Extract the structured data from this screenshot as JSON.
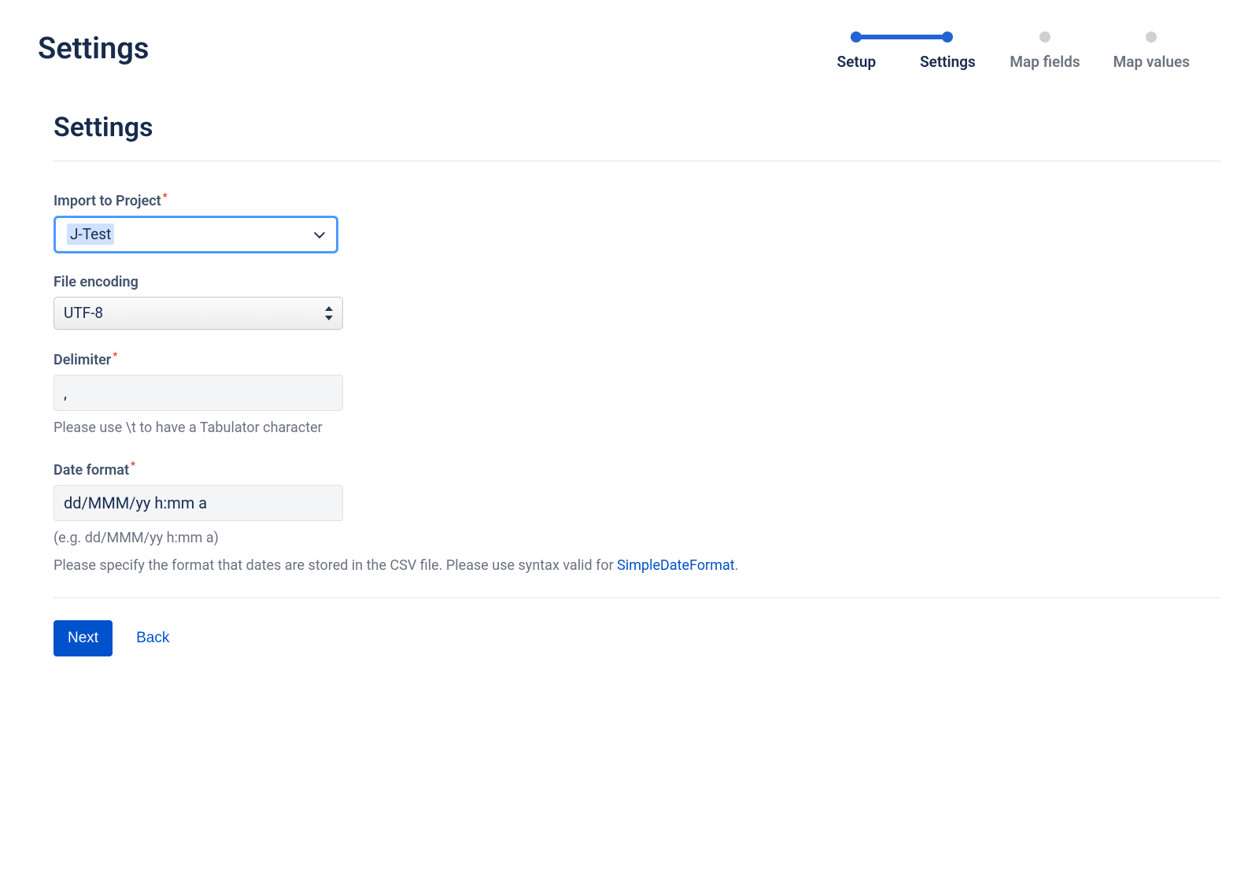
{
  "header": {
    "page_title": "Settings"
  },
  "stepper": {
    "steps": [
      {
        "label": "Setup",
        "state": "done"
      },
      {
        "label": "Settings",
        "state": "current"
      },
      {
        "label": "Map fields",
        "state": "future"
      },
      {
        "label": "Map\nvalues",
        "state": "future"
      }
    ]
  },
  "section": {
    "title": "Settings"
  },
  "fields": {
    "project": {
      "label": "Import to Project",
      "required": true,
      "value": "J-Test"
    },
    "encoding": {
      "label": "File encoding",
      "required": false,
      "value": "UTF-8"
    },
    "delimiter": {
      "label": "Delimiter",
      "required": true,
      "value": ",",
      "help": "Please use \\t to have a Tabulator character"
    },
    "date_format": {
      "label": "Date format",
      "required": true,
      "value": "dd/MMM/yy h:mm a",
      "example": "(e.g. dd/MMM/yy h:mm a)",
      "help_prefix": "Please specify the format that dates are stored in the CSV file. Please use syntax valid for ",
      "help_link": "SimpleDateFormat",
      "help_suffix": "."
    }
  },
  "buttons": {
    "next": "Next",
    "back": "Back"
  }
}
